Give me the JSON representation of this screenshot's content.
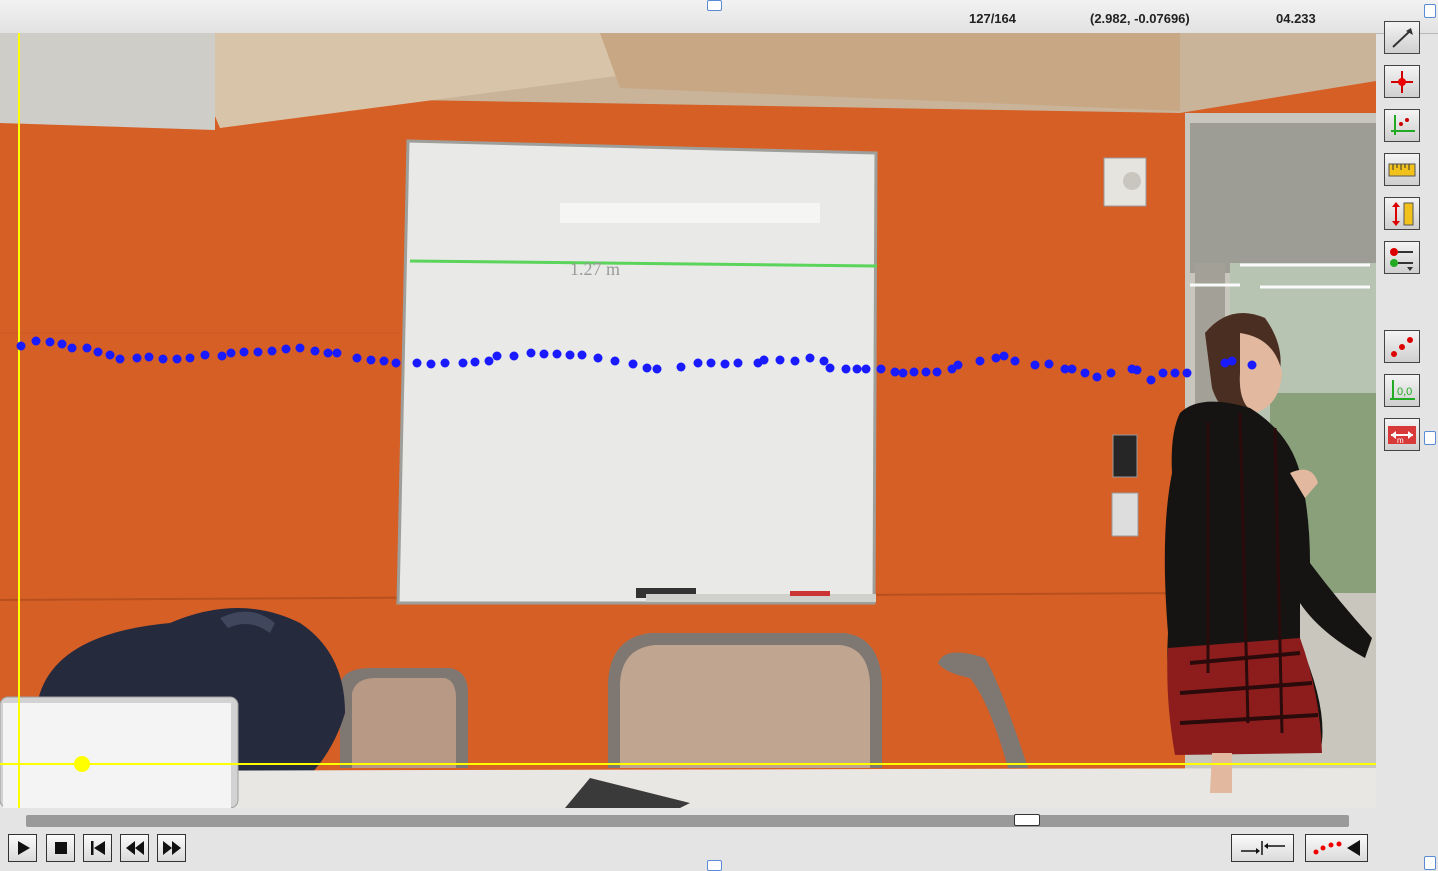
{
  "status": {
    "frame": "127/164",
    "coordinates": "(2.982, -0.07696)",
    "time": "04.233"
  },
  "video": {
    "whiteboard_note": "1.27 m",
    "track_color": "#1a1aff",
    "calibration_color": "#5ad45a",
    "axis_color": "#ffff00"
  },
  "toolbar": {
    "tools": [
      {
        "name": "arrow-tool-icon"
      },
      {
        "name": "add-point-tool-icon"
      },
      {
        "name": "set-origin-axes-tool-icon"
      },
      {
        "name": "ruler-tool-icon"
      },
      {
        "name": "set-scale-tool-icon"
      },
      {
        "name": "options-tool-icon"
      },
      {
        "name": "show-points-tool-icon"
      },
      {
        "name": "show-origin-tool-icon"
      },
      {
        "name": "show-scale-tool-icon"
      }
    ]
  },
  "playback": {
    "buttons": [
      "play",
      "stop",
      "go-to-start",
      "step-back",
      "step-forward"
    ],
    "scrub_position": 0.762
  }
}
